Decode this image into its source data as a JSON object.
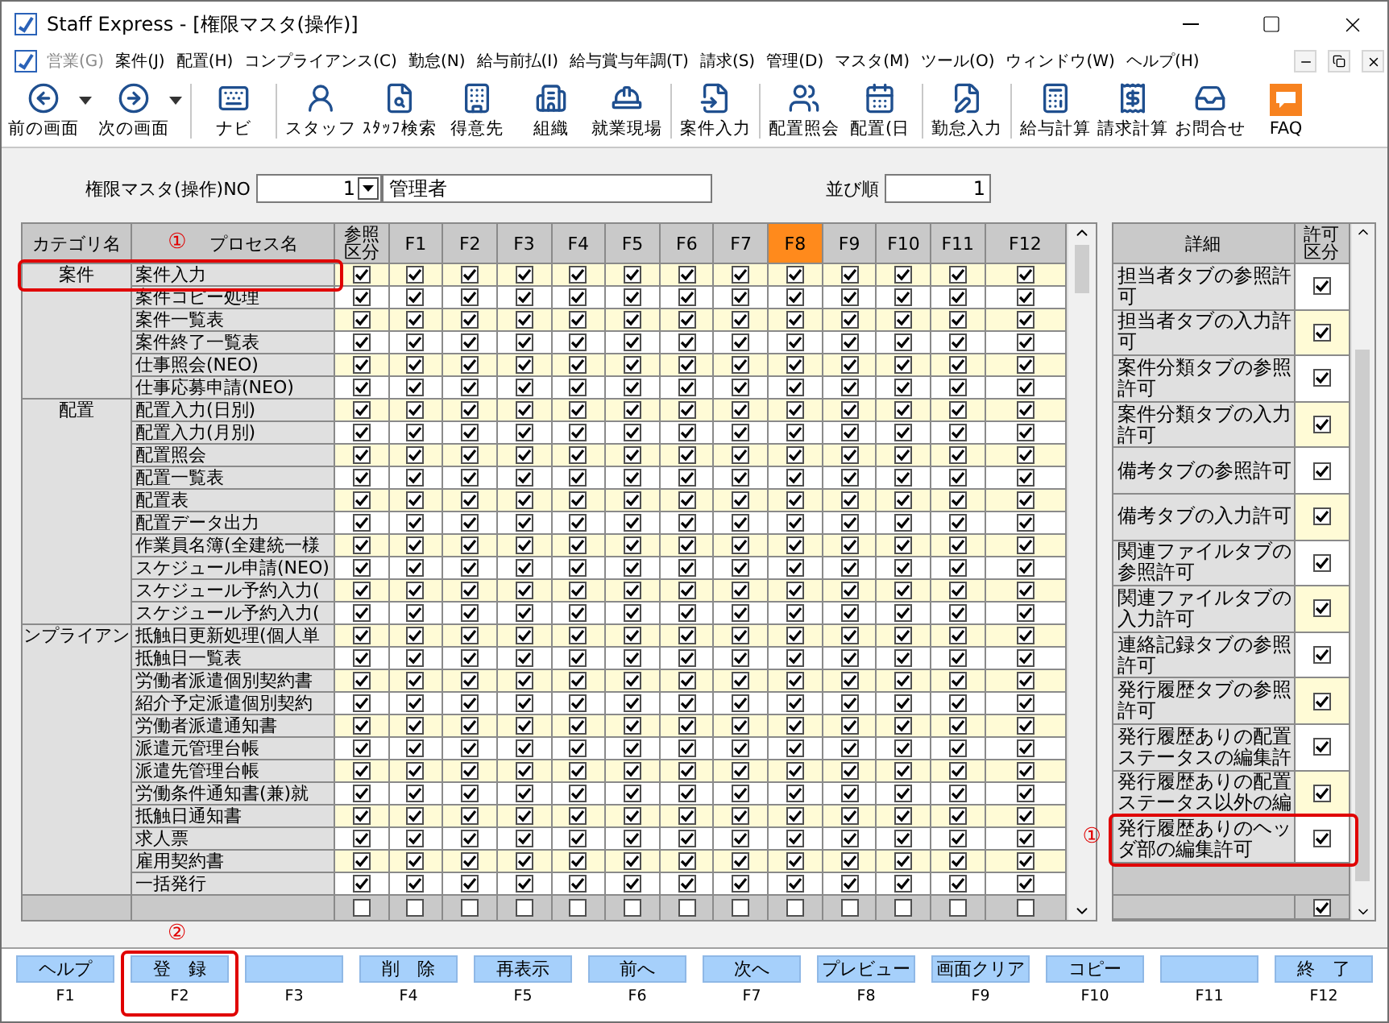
{
  "window": {
    "title": "Staff Express - [権限マスタ(操作)]"
  },
  "menu": [
    {
      "label": "営業(G)",
      "disabled": true
    },
    {
      "label": "案件(J)",
      "disabled": false
    },
    {
      "label": "配置(H)",
      "disabled": false
    },
    {
      "label": "コンプライアンス(C)",
      "disabled": false
    },
    {
      "label": "勤怠(N)",
      "disabled": false
    },
    {
      "label": "給与前払(I)",
      "disabled": false
    },
    {
      "label": "給与賞与年調(T)",
      "disabled": false
    },
    {
      "label": "請求(S)",
      "disabled": false
    },
    {
      "label": "管理(D)",
      "disabled": false
    },
    {
      "label": "マスタ(M)",
      "disabled": false
    },
    {
      "label": "ツール(O)",
      "disabled": false
    },
    {
      "label": "ウィンドウ(W)",
      "disabled": false
    },
    {
      "label": "ヘルプ(H)",
      "disabled": false
    }
  ],
  "toolbar": [
    {
      "items": [
        {
          "label": "前の画面",
          "dropdown": true
        },
        {
          "label": "次の画面",
          "dropdown": true
        }
      ]
    },
    {
      "items": [
        {
          "label": "ナビ",
          "dropdown": false
        }
      ]
    },
    {
      "items": [
        {
          "label": "スタッフ",
          "dropdown": false
        },
        {
          "label": "ｽﾀｯﾌ検索",
          "dropdown": false
        },
        {
          "label": "得意先",
          "dropdown": false
        },
        {
          "label": "組織",
          "dropdown": false
        },
        {
          "label": "就業現場",
          "dropdown": false
        }
      ]
    },
    {
      "items": [
        {
          "label": "案件入力",
          "dropdown": false
        }
      ]
    },
    {
      "items": [
        {
          "label": "配置照会",
          "dropdown": false
        },
        {
          "label": "配置(日",
          "dropdown": false
        }
      ]
    },
    {
      "items": [
        {
          "label": "勤怠入力",
          "dropdown": false
        }
      ]
    },
    {
      "items": [
        {
          "label": "給与計算",
          "dropdown": false
        },
        {
          "label": "請求計算",
          "dropdown": false
        },
        {
          "label": "お問合せ",
          "dropdown": false
        },
        {
          "label": "FAQ",
          "dropdown": false
        }
      ]
    }
  ],
  "form": {
    "no_label": "権限マスタ(操作)NO",
    "no_value": "1",
    "name_value": "管理者",
    "order_label": "並び順",
    "order_value": "1"
  },
  "columns": [
    {
      "label": "カテゴリ名",
      "kind": "text"
    },
    {
      "label": "プロセス名",
      "kind": "text",
      "marker": "①"
    },
    {
      "label": "参照区分",
      "kind": "check",
      "selected": false
    },
    {
      "label": "F1",
      "kind": "check",
      "selected": false
    },
    {
      "label": "F2",
      "kind": "check",
      "selected": false
    },
    {
      "label": "F3",
      "kind": "check",
      "selected": false
    },
    {
      "label": "F4",
      "kind": "check",
      "selected": false
    },
    {
      "label": "F5",
      "kind": "check",
      "selected": false
    },
    {
      "label": "F6",
      "kind": "check",
      "selected": false
    },
    {
      "label": "F7",
      "kind": "check",
      "selected": false
    },
    {
      "label": "F8",
      "kind": "check",
      "selected": true
    },
    {
      "label": "F9",
      "kind": "check",
      "selected": false
    },
    {
      "label": "F10",
      "kind": "check",
      "selected": false
    },
    {
      "label": "F11",
      "kind": "check",
      "selected": false
    },
    {
      "label": "F12",
      "kind": "check",
      "selected": false
    }
  ],
  "categories": [
    {
      "name": "案件",
      "rows": [
        {
          "name": "案件入力",
          "outlined": true,
          "checks": [
            true,
            true,
            true,
            true,
            true,
            true,
            true,
            true,
            true,
            true,
            true,
            true,
            true
          ]
        },
        {
          "name": "案件コピー処理",
          "checks": [
            true,
            true,
            true,
            true,
            true,
            true,
            true,
            true,
            true,
            true,
            true,
            true,
            true
          ]
        },
        {
          "name": "案件一覧表",
          "checks": [
            true,
            true,
            true,
            true,
            true,
            true,
            true,
            true,
            true,
            true,
            true,
            true,
            true
          ]
        },
        {
          "name": "案件終了一覧表",
          "checks": [
            true,
            true,
            true,
            true,
            true,
            true,
            true,
            true,
            true,
            true,
            true,
            true,
            true
          ]
        },
        {
          "name": "仕事照会(NEO)",
          "checks": [
            true,
            true,
            true,
            true,
            true,
            true,
            true,
            true,
            true,
            true,
            true,
            true,
            true
          ]
        },
        {
          "name": "仕事応募申請(NEO)",
          "checks": [
            true,
            true,
            true,
            true,
            true,
            true,
            true,
            true,
            true,
            true,
            true,
            true,
            true
          ]
        }
      ]
    },
    {
      "name": "配置",
      "rows": [
        {
          "name": "配置入力(日別)",
          "checks": [
            true,
            true,
            true,
            true,
            true,
            true,
            true,
            true,
            true,
            true,
            true,
            true,
            true
          ]
        },
        {
          "name": "配置入力(月別)",
          "checks": [
            true,
            true,
            true,
            true,
            true,
            true,
            true,
            true,
            true,
            true,
            true,
            true,
            true
          ]
        },
        {
          "name": "配置照会",
          "checks": [
            true,
            true,
            true,
            true,
            true,
            true,
            true,
            true,
            true,
            true,
            true,
            true,
            true
          ]
        },
        {
          "name": "配置一覧表",
          "checks": [
            true,
            true,
            true,
            true,
            true,
            true,
            true,
            true,
            true,
            true,
            true,
            true,
            true
          ]
        },
        {
          "name": "配置表",
          "checks": [
            true,
            true,
            true,
            true,
            true,
            true,
            true,
            true,
            true,
            true,
            true,
            true,
            true
          ]
        },
        {
          "name": "配置データ出力",
          "checks": [
            true,
            true,
            true,
            true,
            true,
            true,
            true,
            true,
            true,
            true,
            true,
            true,
            true
          ]
        },
        {
          "name": "作業員名簿(全建統一様",
          "checks": [
            true,
            true,
            true,
            true,
            true,
            true,
            true,
            true,
            true,
            true,
            true,
            true,
            true
          ]
        },
        {
          "name": "スケジュール申請(NEO)",
          "checks": [
            true,
            true,
            true,
            true,
            true,
            true,
            true,
            true,
            true,
            true,
            true,
            true,
            true
          ]
        },
        {
          "name": "スケジュール予約入力(",
          "checks": [
            true,
            true,
            true,
            true,
            true,
            true,
            true,
            true,
            true,
            true,
            true,
            true,
            true
          ]
        },
        {
          "name": "スケジュール予約入力(",
          "checks": [
            true,
            true,
            true,
            true,
            true,
            true,
            true,
            true,
            true,
            true,
            true,
            true,
            true
          ]
        }
      ]
    },
    {
      "name": "ンプライアン",
      "rows": [
        {
          "name": "抵触日更新処理(個人単",
          "checks": [
            true,
            true,
            true,
            true,
            true,
            true,
            true,
            true,
            true,
            true,
            true,
            true,
            true
          ]
        },
        {
          "name": "抵触日一覧表",
          "checks": [
            true,
            true,
            true,
            true,
            true,
            true,
            true,
            true,
            true,
            true,
            true,
            true,
            true
          ]
        },
        {
          "name": "労働者派遣個別契約書",
          "checks": [
            true,
            true,
            true,
            true,
            true,
            true,
            true,
            true,
            true,
            true,
            true,
            true,
            true
          ]
        },
        {
          "name": "紹介予定派遣個別契約",
          "checks": [
            true,
            true,
            true,
            true,
            true,
            true,
            true,
            true,
            true,
            true,
            true,
            true,
            true
          ]
        },
        {
          "name": "労働者派遣通知書",
          "checks": [
            true,
            true,
            true,
            true,
            true,
            true,
            true,
            true,
            true,
            true,
            true,
            true,
            true
          ]
        },
        {
          "name": "派遣元管理台帳",
          "checks": [
            true,
            true,
            true,
            true,
            true,
            true,
            true,
            true,
            true,
            true,
            true,
            true,
            true
          ]
        },
        {
          "name": "派遣先管理台帳",
          "checks": [
            true,
            true,
            true,
            true,
            true,
            true,
            true,
            true,
            true,
            true,
            true,
            true,
            true
          ]
        },
        {
          "name": "労働条件通知書(兼)就",
          "checks": [
            true,
            true,
            true,
            true,
            true,
            true,
            true,
            true,
            true,
            true,
            true,
            true,
            true
          ]
        },
        {
          "name": "抵触日通知書",
          "checks": [
            true,
            true,
            true,
            true,
            true,
            true,
            true,
            true,
            true,
            true,
            true,
            true,
            true
          ]
        },
        {
          "name": "求人票",
          "checks": [
            true,
            true,
            true,
            true,
            true,
            true,
            true,
            true,
            true,
            true,
            true,
            true,
            true
          ]
        },
        {
          "name": "雇用契約書",
          "checks": [
            true,
            true,
            true,
            true,
            true,
            true,
            true,
            true,
            true,
            true,
            true,
            true,
            true
          ]
        },
        {
          "name": "一括発行",
          "checks": [
            true,
            true,
            true,
            true,
            true,
            true,
            true,
            true,
            true,
            true,
            true,
            true,
            true
          ]
        }
      ]
    }
  ],
  "footer_checks": [
    false,
    false,
    false,
    false,
    false,
    false,
    false,
    false,
    false,
    false,
    false,
    false,
    false
  ],
  "details": {
    "columns": [
      "詳細",
      "許可区分"
    ],
    "rows": [
      {
        "label": "担当者タブの参照許可",
        "checked": true
      },
      {
        "label": "担当者タブの入力許可",
        "checked": true
      },
      {
        "label": "案件分類タブの参照許可",
        "checked": true
      },
      {
        "label": "案件分類タブの入力許可",
        "checked": true
      },
      {
        "label": "備考タブの参照許可",
        "checked": true
      },
      {
        "label": "備考タブの入力許可",
        "checked": true
      },
      {
        "label": "関連ファイルタブの参照許可",
        "checked": true
      },
      {
        "label": "関連ファイルタブの入力許可",
        "checked": true
      },
      {
        "label": "連絡記録タブの参照許可",
        "checked": true
      },
      {
        "label": "発行履歴タブの参照許可",
        "checked": true
      },
      {
        "label": "発行履歴ありの配置ステータスの編集許",
        "checked": true
      },
      {
        "label": "発行履歴ありの配置ステータス以外の編",
        "checked": true
      },
      {
        "label": "発行履歴ありのヘッダ部の編集許可",
        "checked": true,
        "outlined": true,
        "marker": "①"
      }
    ],
    "footer_checked": true
  },
  "function_keys": [
    {
      "key": "F1",
      "label": "ヘルプ"
    },
    {
      "key": "F2",
      "label": "登　録",
      "outlined": true,
      "marker": "②"
    },
    {
      "key": "F3"
    },
    {
      "key": "F4",
      "label": "削　除"
    },
    {
      "key": "F5",
      "label": "再表示"
    },
    {
      "key": "F6",
      "label": "前へ"
    },
    {
      "key": "F7",
      "label": "次へ"
    },
    {
      "key": "F8",
      "label": "プレビュー"
    },
    {
      "key": "F9",
      "label": "画面クリア"
    },
    {
      "key": "F10",
      "label": "コピー"
    },
    {
      "key": "F11"
    },
    {
      "key": "F12",
      "label": "終　了"
    }
  ]
}
